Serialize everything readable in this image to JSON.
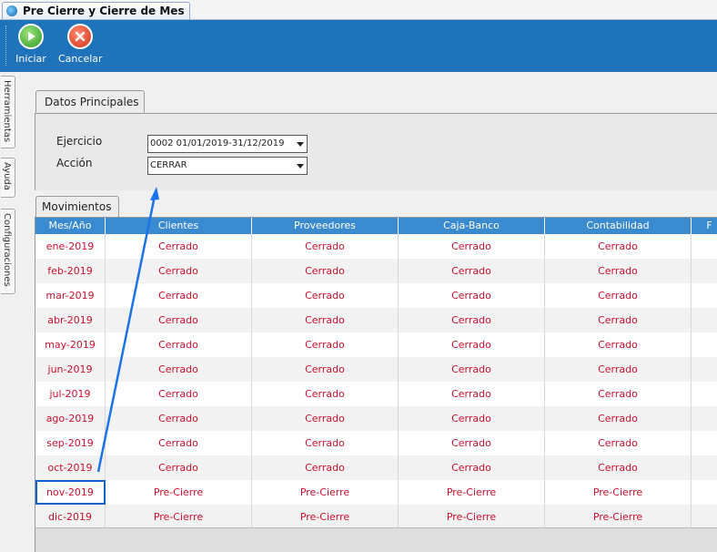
{
  "window": {
    "tab_title": "Pre Cierre y Cierre de Mes"
  },
  "toolbar": {
    "iniciar_label": "Iniciar",
    "cancelar_label": "Cancelar"
  },
  "side_tabs": [
    "Herramientas",
    "Ayuda",
    "Configuraciones"
  ],
  "datos_principales": {
    "tab_label": "Datos Principales",
    "ejercicio_label": "Ejercicio",
    "ejercicio_value": "0002 01/01/2019-31/12/2019",
    "accion_label": "Acción",
    "accion_value": "CERRAR"
  },
  "movimientos": {
    "tab_label": "Movimientos",
    "columns": [
      "Mes/Año",
      "Clientes",
      "Proveedores",
      "Caja-Banco",
      "Contabilidad",
      "F"
    ],
    "rows": [
      [
        "ene-2019",
        "Cerrado",
        "Cerrado",
        "Cerrado",
        "Cerrado"
      ],
      [
        "feb-2019",
        "Cerrado",
        "Cerrado",
        "Cerrado",
        "Cerrado"
      ],
      [
        "mar-2019",
        "Cerrado",
        "Cerrado",
        "Cerrado",
        "Cerrado"
      ],
      [
        "abr-2019",
        "Cerrado",
        "Cerrado",
        "Cerrado",
        "Cerrado"
      ],
      [
        "may-2019",
        "Cerrado",
        "Cerrado",
        "Cerrado",
        "Cerrado"
      ],
      [
        "jun-2019",
        "Cerrado",
        "Cerrado",
        "Cerrado",
        "Cerrado"
      ],
      [
        "jul-2019",
        "Cerrado",
        "Cerrado",
        "Cerrado",
        "Cerrado"
      ],
      [
        "ago-2019",
        "Cerrado",
        "Cerrado",
        "Cerrado",
        "Cerrado"
      ],
      [
        "sep-2019",
        "Cerrado",
        "Cerrado",
        "Cerrado",
        "Cerrado"
      ],
      [
        "oct-2019",
        "Cerrado",
        "Cerrado",
        "Cerrado",
        "Cerrado"
      ],
      [
        "nov-2019",
        "Pre-Cierre",
        "Pre-Cierre",
        "Pre-Cierre",
        "Pre-Cierre"
      ],
      [
        "dic-2019",
        "Pre-Cierre",
        "Pre-Cierre",
        "Pre-Cierre",
        "Pre-Cierre"
      ]
    ],
    "selected_row": 10
  },
  "colors": {
    "accent": "#1e73bb",
    "header": "#3a8ad0",
    "status_text": "#c8102e",
    "annotation": "#1a73e8"
  },
  "icons": {
    "iniciar": "play-icon",
    "cancelar": "cancel-icon"
  }
}
